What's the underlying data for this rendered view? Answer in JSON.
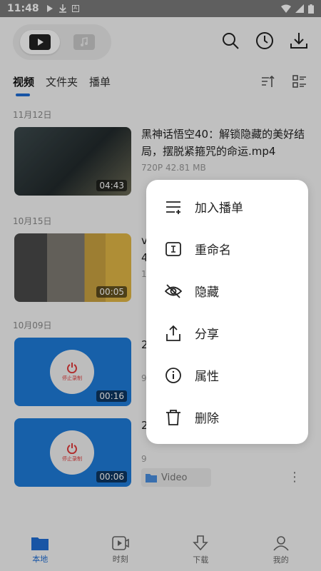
{
  "status": {
    "time": "11:48"
  },
  "tabs": [
    "视频",
    "文件夹",
    "播单"
  ],
  "groups": [
    {
      "date": "11月12日"
    },
    {
      "date": "10月15日"
    },
    {
      "date": "10月09日"
    }
  ],
  "items": [
    {
      "title": "黑神话悟空40：解锁隐藏的美好结局，摆脱紧箍咒的命运.mp4",
      "meta": "720P 42.81 MB",
      "duration": "04:43"
    },
    {
      "title": "v\n4",
      "meta": "1",
      "duration": "00:05"
    },
    {
      "title": "2",
      "meta": "9",
      "duration": "00:16",
      "rec_label": "停止录制"
    },
    {
      "title": "2",
      "meta": "9",
      "duration": "00:06",
      "rec_label": "停止录制",
      "folder": "Video"
    }
  ],
  "menu": [
    "加入播单",
    "重命名",
    "隐藏",
    "分享",
    "属性",
    "删除"
  ],
  "nav": [
    "本地",
    "时刻",
    "下载",
    "我的"
  ],
  "colors": {
    "accent": "#1f6ed4",
    "rec_red": "#e23b3b",
    "thumb_blue": "#1e7bd9"
  }
}
